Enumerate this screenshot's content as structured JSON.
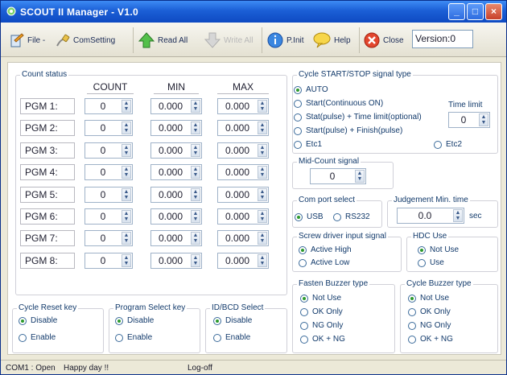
{
  "window": {
    "title": "SCOUT II  Manager - V1.0",
    "minimize": "_",
    "maximize": "□",
    "close": "×"
  },
  "toolbar": {
    "file": "File -",
    "comsetting": "ComSetting",
    "readall": "Read All",
    "writeall": "Write All",
    "pinit": "P.Init",
    "help": "Help",
    "close": "Close",
    "version": "Version:0"
  },
  "count_status": {
    "title": "Count status",
    "headers": [
      "COUNT",
      "MIN",
      "MAX"
    ],
    "rows": [
      {
        "label": "PGM 1:",
        "count": "0",
        "min": "0.000",
        "max": "0.000"
      },
      {
        "label": "PGM 2:",
        "count": "0",
        "min": "0.000",
        "max": "0.000"
      },
      {
        "label": "PGM 3:",
        "count": "0",
        "min": "0.000",
        "max": "0.000"
      },
      {
        "label": "PGM 4:",
        "count": "0",
        "min": "0.000",
        "max": "0.000"
      },
      {
        "label": "PGM 5:",
        "count": "0",
        "min": "0.000",
        "max": "0.000"
      },
      {
        "label": "PGM 6:",
        "count": "0",
        "min": "0.000",
        "max": "0.000"
      },
      {
        "label": "PGM 7:",
        "count": "0",
        "min": "0.000",
        "max": "0.000"
      },
      {
        "label": "PGM 8:",
        "count": "0",
        "min": "0.000",
        "max": "0.000"
      }
    ]
  },
  "cycle_reset": {
    "title": "Cycle Reset key",
    "options": [
      "Disable",
      "Enable"
    ],
    "selected": "Disable"
  },
  "program_select": {
    "title": "Program Select key",
    "options": [
      "Disable",
      "Enable"
    ],
    "selected": "Disable"
  },
  "idbcd_select": {
    "title": "ID/BCD Select",
    "options": [
      "Disable",
      "Enable"
    ],
    "selected": "Disable"
  },
  "cycle_signal": {
    "title": "Cycle START/STOP signal type",
    "options": [
      "AUTO",
      "Start(Continuous ON)",
      "Stat(pulse) + Time limit(optional)",
      "Start(pulse) + Finish(pulse)",
      "Etc1",
      "Etc2"
    ],
    "selected": "AUTO",
    "time_limit_label": "Time limit",
    "time_limit": "0"
  },
  "mid_count": {
    "title": "Mid-Count signal",
    "value": "0"
  },
  "com_port": {
    "title": "Com port select",
    "options": [
      "USB",
      "RS232"
    ],
    "selected": "USB"
  },
  "judgement": {
    "title": "Judgement Min. time",
    "value": "0.0",
    "unit": "sec"
  },
  "screw_driver": {
    "title": "Screw driver input signal",
    "options": [
      "Active High",
      "Active Low"
    ],
    "selected": "Active High"
  },
  "hdc_use": {
    "title": "HDC Use",
    "options": [
      "Not Use",
      "Use"
    ],
    "selected": "Not Use"
  },
  "fasten_buzzer": {
    "title": "Fasten Buzzer type",
    "options": [
      "Not Use",
      "OK Only",
      "NG Only",
      "OK + NG"
    ],
    "selected": "Not Use"
  },
  "cycle_buzzer": {
    "title": "Cycle Buzzer type",
    "options": [
      "Not Use",
      "OK Only",
      "NG Only",
      "OK + NG"
    ],
    "selected": "Not Use"
  },
  "status_bar": {
    "port": "COM1 : Open",
    "message": "Happy day !!",
    "log": "Log-off"
  }
}
